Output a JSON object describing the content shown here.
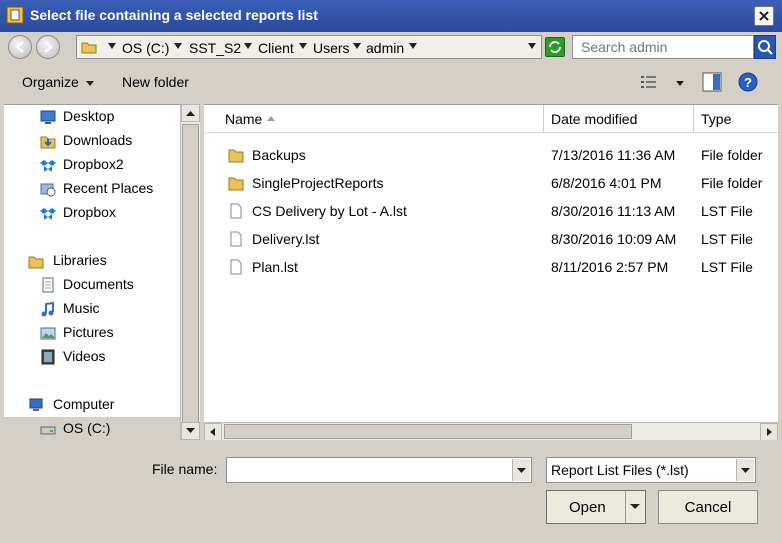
{
  "window": {
    "title": "Select file containing a selected reports list"
  },
  "address": {
    "breadcrumbs": [
      "OS (C:)",
      "SST_S2",
      "Client",
      "Users",
      "admin"
    ]
  },
  "search": {
    "placeholder": "Search admin"
  },
  "toolbar": {
    "organize_label": "Organize",
    "new_folder_label": "New folder"
  },
  "sidebar": {
    "items": [
      {
        "label": "Desktop",
        "icon": "desktop-icon"
      },
      {
        "label": "Downloads",
        "icon": "downloads-icon"
      },
      {
        "label": "Dropbox2",
        "icon": "dropbox-icon"
      },
      {
        "label": "Recent Places",
        "icon": "recent-places-icon"
      },
      {
        "label": "Dropbox",
        "icon": "dropbox-icon"
      },
      {
        "label": "Libraries",
        "icon": "libraries-icon"
      },
      {
        "label": "Documents",
        "icon": "documents-icon"
      },
      {
        "label": "Music",
        "icon": "music-icon"
      },
      {
        "label": "Pictures",
        "icon": "pictures-icon"
      },
      {
        "label": "Videos",
        "icon": "videos-icon"
      },
      {
        "label": "Computer",
        "icon": "computer-icon"
      },
      {
        "label": "OS (C:)",
        "icon": "drive-icon"
      }
    ]
  },
  "file_list": {
    "columns": [
      "Name",
      "Date modified",
      "Type"
    ],
    "rows": [
      {
        "name": "Backups",
        "date": "7/13/2016 11:36 AM",
        "type": "File folder",
        "icon": "folder-icon"
      },
      {
        "name": "SingleProjectReports",
        "date": "6/8/2016 4:01 PM",
        "type": "File folder",
        "icon": "folder-icon"
      },
      {
        "name": "CS Delivery by Lot - A.lst",
        "date": "8/30/2016 11:13 AM",
        "type": "LST File",
        "icon": "file-icon"
      },
      {
        "name": "Delivery.lst",
        "date": "8/30/2016 10:09 AM",
        "type": "LST File",
        "icon": "file-icon"
      },
      {
        "name": "Plan.lst",
        "date": "8/11/2016 2:57 PM",
        "type": "LST File",
        "icon": "file-icon"
      }
    ]
  },
  "bottom": {
    "file_name_label": "File name:",
    "file_name_value": "",
    "filter_value": "Report List Files (*.lst)",
    "open_label": "Open",
    "cancel_label": "Cancel"
  }
}
